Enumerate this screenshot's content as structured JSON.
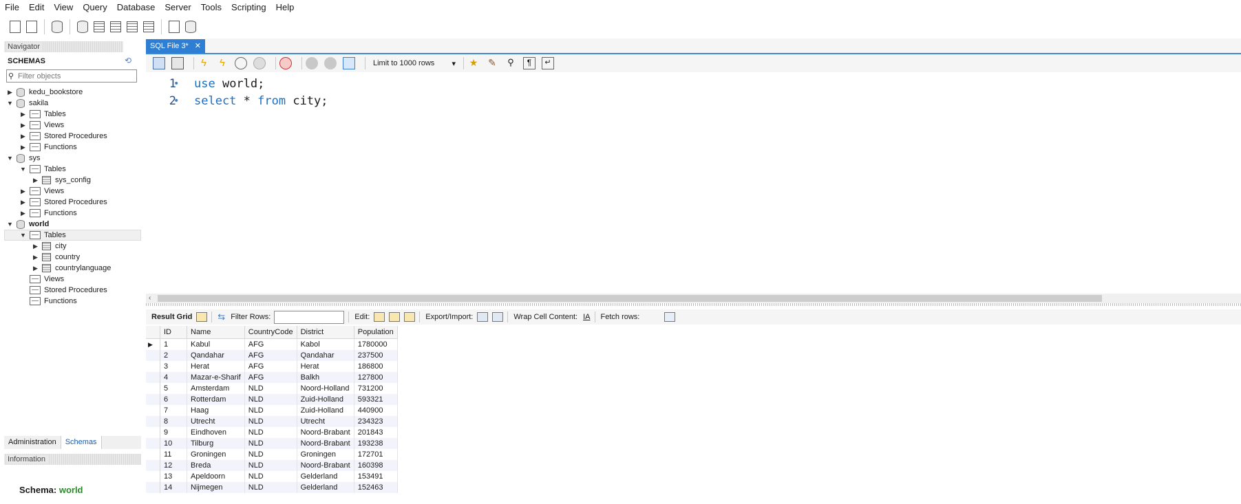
{
  "menu": [
    "File",
    "Edit",
    "View",
    "Query",
    "Database",
    "Server",
    "Tools",
    "Scripting",
    "Help"
  ],
  "toolbar_icons": [
    "new-sql-tab-icon",
    "open-sql-script-icon",
    "inspector-icon",
    "create-schema-icon",
    "create-table-icon",
    "create-view-icon",
    "create-procedure-icon",
    "create-function-icon",
    "search-table-data-icon",
    "reconnect-icon"
  ],
  "navigator": {
    "header": "Navigator",
    "schemas_label": "SCHEMAS",
    "filter_placeholder": "Filter objects",
    "tree": [
      {
        "label": "kedu_bookstore",
        "level": 0,
        "expanded": false,
        "icon": "db",
        "bold": false
      },
      {
        "label": "sakila",
        "level": 0,
        "expanded": true,
        "icon": "db",
        "bold": false
      },
      {
        "label": "Tables",
        "level": 1,
        "expanded": false,
        "icon": "folder",
        "bold": false
      },
      {
        "label": "Views",
        "level": 1,
        "expanded": false,
        "icon": "folder",
        "bold": false
      },
      {
        "label": "Stored Procedures",
        "level": 1,
        "expanded": false,
        "icon": "folder",
        "bold": false
      },
      {
        "label": "Functions",
        "level": 1,
        "expanded": false,
        "icon": "folder",
        "bold": false
      },
      {
        "label": "sys",
        "level": 0,
        "expanded": true,
        "icon": "db",
        "bold": false
      },
      {
        "label": "Tables",
        "level": 1,
        "expanded": true,
        "icon": "folder",
        "bold": false
      },
      {
        "label": "sys_config",
        "level": 2,
        "expanded": false,
        "icon": "table",
        "bold": false
      },
      {
        "label": "Views",
        "level": 1,
        "expanded": false,
        "icon": "folder",
        "bold": false
      },
      {
        "label": "Stored Procedures",
        "level": 1,
        "expanded": false,
        "icon": "folder",
        "bold": false
      },
      {
        "label": "Functions",
        "level": 1,
        "expanded": false,
        "icon": "folder",
        "bold": false
      },
      {
        "label": "world",
        "level": 0,
        "expanded": true,
        "icon": "db",
        "bold": true
      },
      {
        "label": "Tables",
        "level": 1,
        "expanded": true,
        "icon": "folder",
        "bold": false
      },
      {
        "label": "city",
        "level": 2,
        "expanded": false,
        "icon": "table",
        "bold": false
      },
      {
        "label": "country",
        "level": 2,
        "expanded": false,
        "icon": "table",
        "bold": false
      },
      {
        "label": "countrylanguage",
        "level": 2,
        "expanded": false,
        "icon": "table",
        "bold": false
      },
      {
        "label": "Views",
        "level": 1,
        "expanded": null,
        "icon": "folder",
        "bold": false
      },
      {
        "label": "Stored Procedures",
        "level": 1,
        "expanded": null,
        "icon": "folder",
        "bold": false
      },
      {
        "label": "Functions",
        "level": 1,
        "expanded": null,
        "icon": "folder",
        "bold": false
      }
    ]
  },
  "bottom_tabs": {
    "administration": "Administration",
    "schemas": "Schemas"
  },
  "information": {
    "header": "Information",
    "schema_label": "Schema:",
    "schema_value": "world"
  },
  "editor": {
    "tab_title": "SQL File 3*",
    "limit_label": "Limit to 1000 rows",
    "lines": [
      {
        "num": "1",
        "parts": [
          {
            "t": "use",
            "kw": true
          },
          {
            "t": " world;",
            "kw": false
          }
        ]
      },
      {
        "num": "2",
        "parts": [
          {
            "t": "select",
            "kw": true
          },
          {
            "t": " * ",
            "kw": false
          },
          {
            "t": "from",
            "kw": true
          },
          {
            "t": " city;",
            "kw": false
          }
        ]
      }
    ]
  },
  "result_toolbar": {
    "result_grid": "Result Grid",
    "filter_rows": "Filter Rows:",
    "edit": "Edit:",
    "export_import": "Export/Import:",
    "wrap_cell": "Wrap Cell Content:",
    "fetch_rows": "Fetch rows:"
  },
  "grid": {
    "columns": [
      "ID",
      "Name",
      "CountryCode",
      "District",
      "Population"
    ],
    "rows": [
      [
        "1",
        "Kabul",
        "AFG",
        "Kabol",
        "1780000"
      ],
      [
        "2",
        "Qandahar",
        "AFG",
        "Qandahar",
        "237500"
      ],
      [
        "3",
        "Herat",
        "AFG",
        "Herat",
        "186800"
      ],
      [
        "4",
        "Mazar-e-Sharif",
        "AFG",
        "Balkh",
        "127800"
      ],
      [
        "5",
        "Amsterdam",
        "NLD",
        "Noord-Holland",
        "731200"
      ],
      [
        "6",
        "Rotterdam",
        "NLD",
        "Zuid-Holland",
        "593321"
      ],
      [
        "7",
        "Haag",
        "NLD",
        "Zuid-Holland",
        "440900"
      ],
      [
        "8",
        "Utrecht",
        "NLD",
        "Utrecht",
        "234323"
      ],
      [
        "9",
        "Eindhoven",
        "NLD",
        "Noord-Brabant",
        "201843"
      ],
      [
        "10",
        "Tilburg",
        "NLD",
        "Noord-Brabant",
        "193238"
      ],
      [
        "11",
        "Groningen",
        "NLD",
        "Groningen",
        "172701"
      ],
      [
        "12",
        "Breda",
        "NLD",
        "Noord-Brabant",
        "160398"
      ],
      [
        "13",
        "Apeldoorn",
        "NLD",
        "Gelderland",
        "153491"
      ],
      [
        "14",
        "Nijmegen",
        "NLD",
        "Gelderland",
        "152463"
      ]
    ]
  }
}
